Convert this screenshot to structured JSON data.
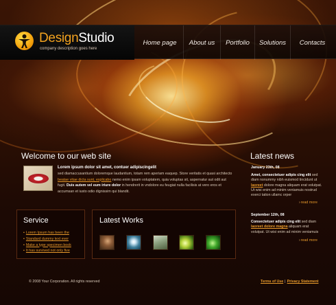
{
  "header": {
    "logo_part1": "Design",
    "logo_part2": "Studio",
    "tagline": "company description goes here",
    "nav": [
      "Home page",
      "About us",
      "Portfolio",
      "Solutions",
      "Contacts"
    ]
  },
  "welcome": {
    "title": "Welcome to our web site",
    "lead": "Lorem ipsum dolor sit amet, contuer adipiscingelit",
    "p1_before": "sed diamaccusantium doloremque laudantium, totam rem aperiam eaquep. Store veritatis et quasi architecto ",
    "p1_link": "beatae vitae dicta sunt, explicabo",
    "p1_after": " nemo enim ipsam voluptatem, quia voluptas sit, aspernatur aut odit aut fugit. ",
    "p2_bold": "Duis autem vel eum iriure dolor",
    "p2_rest": " in hendrerit in vndolore eu feugiat nulla facilisis at vero eros et accumsan et iusto odio dignissim qui blandit."
  },
  "service": {
    "title": "Service",
    "items": [
      "Lorem Ipsum has been the",
      "Standard dummy text ever",
      "Make a type specimen book",
      "It has survived not only five"
    ]
  },
  "works": {
    "title": "Latest Works"
  },
  "news": {
    "title": "Latest news",
    "items": [
      {
        "date": "January 23th, 08",
        "headline": "Amet, consectetuer adipis cing elit",
        "t1": " sed diam nonummy nibh euismod tincidunt ut ",
        "link": "laoreet",
        "t2": " dolore magna aliquam erat volutpat. Ut wisi enim ad minim veniamuis nostrud exerci tation ullamc orper",
        "more": "read more"
      },
      {
        "date": "September 12th, 08",
        "headline": "Consectetuer adipis cing elit",
        "t1": " sed diam ",
        "link": "laoreet dolore magna",
        "t2": " aliquam erat volutpat. Ut wisi enim ad minim veniamuis",
        "more": "read more"
      }
    ]
  },
  "footer": {
    "copyright": "© 2008 Your Corporation. All rights reserved",
    "terms": "Terms of Use",
    "separator": "|",
    "privacy": "Privacy Statement"
  },
  "colors": {
    "accent": "#f3a21f",
    "link": "#e89a2b",
    "background": "#1a0903"
  }
}
